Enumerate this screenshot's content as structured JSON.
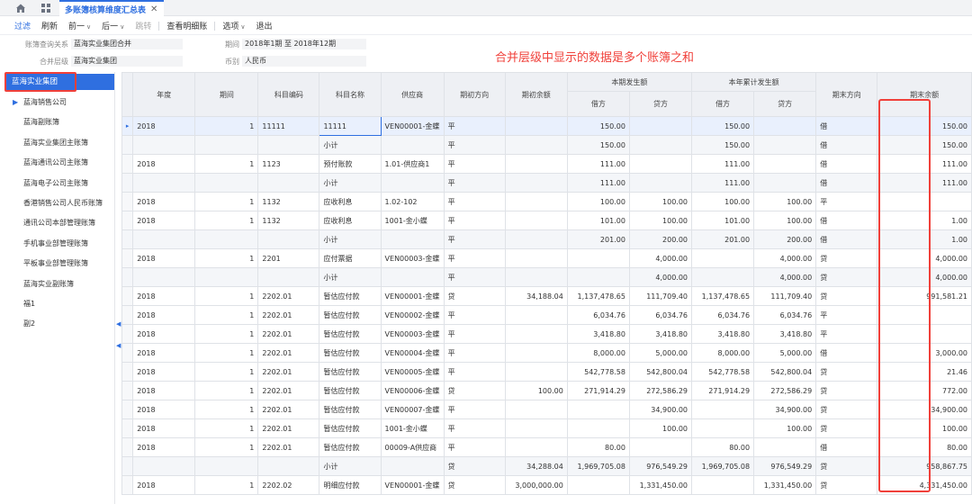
{
  "tab": {
    "title": "多账簿核算维度汇总表",
    "close": "✕"
  },
  "toolbar": [
    {
      "label": "过滤",
      "style": "first"
    },
    {
      "label": "刷新"
    },
    {
      "label": "前一",
      "caret": true
    },
    {
      "label": "后一",
      "caret": true
    },
    {
      "label": "跳转",
      "style": "disabled"
    },
    {
      "label": "查看明细账"
    },
    {
      "label": "选项",
      "caret": true
    },
    {
      "label": "退出"
    }
  ],
  "filter": {
    "book_relation_label": "账簿查询关系",
    "book_relation_value": "蓝海实业集团合并",
    "merge_level_label": "合并层级",
    "merge_level_value": "蓝海实业集团",
    "period_label": "期间",
    "period_value": "2018年1期 至 2018年12期",
    "currency_label": "币别",
    "currency_value": "人民币"
  },
  "annotation": "合并层级中显示的数据是多个账簿之和",
  "sidebar": {
    "root": "蓝海实业集团",
    "items": [
      "蓝海销售公司",
      "蓝海副账簿",
      "蓝海实业集团主账簿",
      "蓝海通讯公司主账簿",
      "蓝海电子公司主账簿",
      "香港销售公司人民币账簿",
      "通讯公司本部管理账簿",
      "手机事业部管理账簿",
      "平板事业部管理账簿",
      "蓝海实业副账簿",
      "福1",
      "副2"
    ]
  },
  "table": {
    "group_current": "本期发生额",
    "group_ytd": "本年累计发生额",
    "headers": [
      "年度",
      "期间",
      "科目编码",
      "科目名称",
      "供应商",
      "期初方向",
      "期初余额",
      "借方",
      "贷方",
      "借方",
      "贷方",
      "期末方向",
      "期末余额"
    ],
    "rows": [
      {
        "type": "sel",
        "c": [
          "2018",
          "1",
          "11111",
          "11111",
          "VEN00001-金蝶",
          "平",
          "",
          "150.00",
          "",
          "150.00",
          "",
          "借",
          "150.00"
        ]
      },
      {
        "type": "sub",
        "c": [
          "",
          "",
          "",
          "小计",
          "",
          "平",
          "",
          "150.00",
          "",
          "150.00",
          "",
          "借",
          "150.00"
        ]
      },
      {
        "type": "data",
        "c": [
          "2018",
          "1",
          "1123",
          "预付账款",
          "1.01-供应商1",
          "平",
          "",
          "111.00",
          "",
          "111.00",
          "",
          "借",
          "111.00"
        ]
      },
      {
        "type": "sub",
        "c": [
          "",
          "",
          "",
          "小计",
          "",
          "平",
          "",
          "111.00",
          "",
          "111.00",
          "",
          "借",
          "111.00"
        ]
      },
      {
        "type": "data",
        "c": [
          "2018",
          "1",
          "1132",
          "应收利息",
          "1.02-102",
          "平",
          "",
          "100.00",
          "100.00",
          "100.00",
          "100.00",
          "平",
          ""
        ]
      },
      {
        "type": "data",
        "c": [
          "2018",
          "1",
          "1132",
          "应收利息",
          "1001-金小蝶",
          "平",
          "",
          "101.00",
          "100.00",
          "101.00",
          "100.00",
          "借",
          "1.00"
        ]
      },
      {
        "type": "sub",
        "c": [
          "",
          "",
          "",
          "小计",
          "",
          "平",
          "",
          "201.00",
          "200.00",
          "201.00",
          "200.00",
          "借",
          "1.00"
        ]
      },
      {
        "type": "data",
        "c": [
          "2018",
          "1",
          "2201",
          "应付票据",
          "VEN00003-金蝶",
          "平",
          "",
          "",
          "4,000.00",
          "",
          "4,000.00",
          "贷",
          "4,000.00"
        ]
      },
      {
        "type": "sub",
        "c": [
          "",
          "",
          "",
          "小计",
          "",
          "平",
          "",
          "",
          "4,000.00",
          "",
          "4,000.00",
          "贷",
          "4,000.00"
        ]
      },
      {
        "type": "data",
        "c": [
          "2018",
          "1",
          "2202.01",
          "暂估应付款",
          "VEN00001-金蝶",
          "贷",
          "34,188.04",
          "1,137,478.65",
          "111,709.40",
          "1,137,478.65",
          "111,709.40",
          "贷",
          "991,581.21"
        ]
      },
      {
        "type": "data",
        "c": [
          "2018",
          "1",
          "2202.01",
          "暂估应付款",
          "VEN00002-金蝶",
          "平",
          "",
          "6,034.76",
          "6,034.76",
          "6,034.76",
          "6,034.76",
          "平",
          ""
        ]
      },
      {
        "type": "data",
        "c": [
          "2018",
          "1",
          "2202.01",
          "暂估应付款",
          "VEN00003-金蝶",
          "平",
          "",
          "3,418.80",
          "3,418.80",
          "3,418.80",
          "3,418.80",
          "平",
          ""
        ]
      },
      {
        "type": "data",
        "c": [
          "2018",
          "1",
          "2202.01",
          "暂估应付款",
          "VEN00004-金蝶",
          "平",
          "",
          "8,000.00",
          "5,000.00",
          "8,000.00",
          "5,000.00",
          "借",
          "3,000.00"
        ]
      },
      {
        "type": "data",
        "c": [
          "2018",
          "1",
          "2202.01",
          "暂估应付款",
          "VEN00005-金蝶",
          "平",
          "",
          "542,778.58",
          "542,800.04",
          "542,778.58",
          "542,800.04",
          "贷",
          "21.46"
        ]
      },
      {
        "type": "data",
        "c": [
          "2018",
          "1",
          "2202.01",
          "暂估应付款",
          "VEN00006-金蝶",
          "贷",
          "100.00",
          "271,914.29",
          "272,586.29",
          "271,914.29",
          "272,586.29",
          "贷",
          "772.00"
        ]
      },
      {
        "type": "data",
        "c": [
          "2018",
          "1",
          "2202.01",
          "暂估应付款",
          "VEN00007-金蝶",
          "平",
          "",
          "",
          "34,900.00",
          "",
          "34,900.00",
          "贷",
          "34,900.00"
        ]
      },
      {
        "type": "data",
        "c": [
          "2018",
          "1",
          "2202.01",
          "暂估应付款",
          "1001-金小蝶",
          "平",
          "",
          "",
          "100.00",
          "",
          "100.00",
          "贷",
          "100.00"
        ]
      },
      {
        "type": "data",
        "c": [
          "2018",
          "1",
          "2202.01",
          "暂估应付款",
          "00009-A供应商",
          "平",
          "",
          "80.00",
          "",
          "80.00",
          "",
          "借",
          "80.00"
        ]
      },
      {
        "type": "sub",
        "c": [
          "",
          "",
          "",
          "小计",
          "",
          "贷",
          "34,288.04",
          "1,969,705.08",
          "976,549.29",
          "1,969,705.08",
          "976,549.29",
          "贷",
          "958,867.75"
        ]
      },
      {
        "type": "data",
        "c": [
          "2018",
          "1",
          "2202.02",
          "明细应付款",
          "VEN00001-金蝶",
          "贷",
          "3,000,000.00",
          "",
          "1,331,450.00",
          "",
          "1,331,450.00",
          "贷",
          "4,331,450.00"
        ]
      }
    ]
  }
}
